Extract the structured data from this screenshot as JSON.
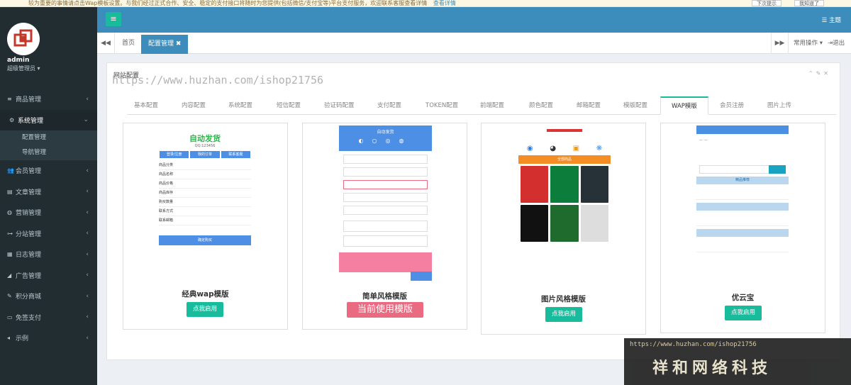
{
  "notice": {
    "text": "较为重要的事情请点击Wap模板设置。与我们经过正式合作、安全、稳定的支付接口将随时为您提供(包括微信/支付宝等)平台支付服务，欢迎联系客服查看详情",
    "link": "查看详情",
    "btn_later": "下次提示",
    "btn_ok": "我知道了"
  },
  "user": {
    "name": "admin",
    "role": "超级管理员"
  },
  "menu": [
    {
      "label": "商品管理",
      "icon": "≡"
    },
    {
      "label": "系统管理",
      "icon": "⚙",
      "active": true
    },
    {
      "label": "会员管理",
      "icon": "👥"
    },
    {
      "label": "文章管理",
      "icon": "▤"
    },
    {
      "label": "营销管理",
      "icon": "◍"
    },
    {
      "label": "分站管理",
      "icon": "⊶"
    },
    {
      "label": "日志管理",
      "icon": "▦"
    },
    {
      "label": "广告管理",
      "icon": "◢"
    },
    {
      "label": "积分商城",
      "icon": "✎"
    },
    {
      "label": "免签支付",
      "icon": "▭"
    },
    {
      "label": "示例",
      "icon": "◂"
    }
  ],
  "submenu": [
    "配置管理",
    "导航管理"
  ],
  "topbar": {
    "theme": "主题"
  },
  "tabs": {
    "home": "首页",
    "current": "配置管理",
    "common_ops": "常用操作",
    "logout": "退出"
  },
  "panel": {
    "title": "网站配置"
  },
  "config_tabs": [
    "基本配置",
    "内容配置",
    "系统配置",
    "短信配置",
    "验证码配置",
    "支付配置",
    "TOKEN配置",
    "前端配置",
    "颜色配置",
    "邮箱配置",
    "模版配置",
    "WAP模版",
    "会员注册",
    "图片上传"
  ],
  "active_config_tab": "WAP模版",
  "templates": [
    {
      "name": "经典wap模版",
      "button": "点我启用"
    },
    {
      "name": "简单风格模版",
      "current_label": "当前使用模版"
    },
    {
      "name": "图片风格模版",
      "button": "点我启用"
    },
    {
      "name": "优云宝",
      "button": "点我启用"
    }
  ],
  "mini": {
    "t1_title": "自动发货",
    "t1_qq": "QQ:123456",
    "t1_btns": [
      "登录/注册",
      "我的订单",
      "联系客服"
    ],
    "t1_rows": [
      "商品分类",
      "商品名称",
      "商品价格",
      "商品库存",
      "购买数量",
      "联系方式",
      "联系邮箱"
    ],
    "t1_submit": "确定购买",
    "t2_title": "自动发货",
    "t3_banner": "全部商品",
    "t4_bar": "精品推荐"
  },
  "watermark_url": "https://www.huzhan.com/ishop21756",
  "brand_url": "https://www.huzhan.com/ishop21756",
  "brand_cn": "祥和网络科技",
  "colors": {
    "sidebar": "#222d32",
    "topbar": "#3c8dbc",
    "accent": "#18bc9c",
    "current": "#e96a81"
  }
}
